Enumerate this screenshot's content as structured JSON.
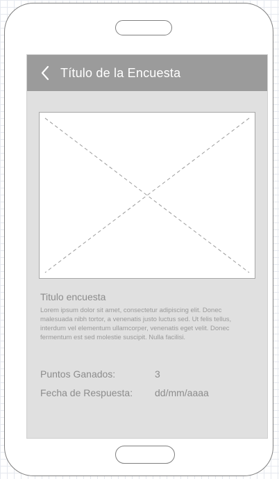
{
  "app_bar": {
    "title": "Título de la Encuesta"
  },
  "survey": {
    "title": "Titulo encuesta",
    "description": "Lorem ipsum dolor sit amet, consectetur adipiscing elit. Donec malesuada nibh tortor, a venenatis justo luctus sed. Ut felis tellus, interdum vel elementum ullamcorper, venenatis eget velit. Donec fermentum est sed molestie suscipit. Nulla facilisi.",
    "points_label": "Puntos Ganados:",
    "points_value": "3",
    "date_label": "Fecha de Respuesta:",
    "date_value": "dd/mm/aaaa"
  },
  "icons": {
    "back": "chevron-left-icon",
    "image": "image-placeholder"
  },
  "colors": {
    "app_bar": "#9b9b9b",
    "screen_bg": "#e0e0e0",
    "text": "#8c8c8c",
    "device_outline": "#7f7f7f"
  }
}
